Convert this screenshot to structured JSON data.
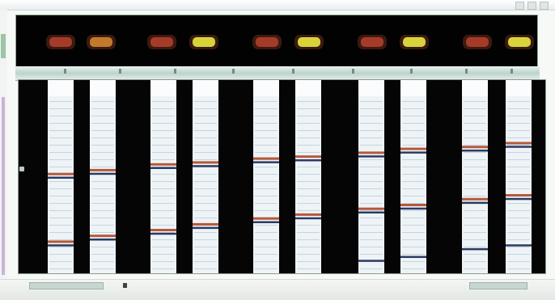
{
  "colors": {
    "panel_background": "#040404",
    "lane_background": "#eef3f6",
    "top_well_red": "#a63a28",
    "top_well_yellow": "#d9d33b",
    "band_red": "#b5583a",
    "band_dark": "#2c3a63",
    "band_cyan": "#4aa3b8"
  },
  "icons": {
    "minimize": "minimize-icon",
    "maximize": "maximize-icon",
    "close": "close-icon"
  },
  "top_wells": [
    {
      "name": "top-well-1",
      "color": "red"
    },
    {
      "name": "top-well-2",
      "color": "orange"
    },
    {
      "name": "top-well-3",
      "color": "red"
    },
    {
      "name": "top-well-4",
      "color": "yellow"
    },
    {
      "name": "top-well-5",
      "color": "red"
    },
    {
      "name": "top-well-6",
      "color": "yellow"
    },
    {
      "name": "top-well-7",
      "color": "red"
    },
    {
      "name": "top-well-8",
      "color": "yellow"
    },
    {
      "name": "top-well-9",
      "color": "red"
    },
    {
      "name": "top-well-10",
      "color": "yellow"
    }
  ],
  "lanes": [
    {
      "name": "lane-1",
      "bands": [
        {
          "level": 0.48,
          "tone": "red"
        },
        {
          "level": 0.5,
          "tone": "dark"
        },
        {
          "level": 0.83,
          "tone": "red"
        },
        {
          "level": 0.85,
          "tone": "dark"
        }
      ]
    },
    {
      "name": "lane-2",
      "bands": [
        {
          "level": 0.46,
          "tone": "red"
        },
        {
          "level": 0.48,
          "tone": "dark"
        },
        {
          "level": 0.8,
          "tone": "red"
        },
        {
          "level": 0.82,
          "tone": "dark"
        }
      ]
    },
    {
      "name": "lane-3",
      "bands": [
        {
          "level": 0.43,
          "tone": "red"
        },
        {
          "level": 0.45,
          "tone": "dark"
        },
        {
          "level": 0.77,
          "tone": "red"
        },
        {
          "level": 0.79,
          "tone": "dark"
        }
      ]
    },
    {
      "name": "lane-4",
      "bands": [
        {
          "level": 0.42,
          "tone": "red"
        },
        {
          "level": 0.44,
          "tone": "dark"
        },
        {
          "level": 0.74,
          "tone": "red"
        },
        {
          "level": 0.76,
          "tone": "dark"
        }
      ]
    },
    {
      "name": "lane-5",
      "bands": [
        {
          "level": 0.4,
          "tone": "red"
        },
        {
          "level": 0.42,
          "tone": "dark"
        },
        {
          "level": 0.71,
          "tone": "red"
        },
        {
          "level": 0.73,
          "tone": "dark"
        }
      ]
    },
    {
      "name": "lane-6",
      "bands": [
        {
          "level": 0.39,
          "tone": "red"
        },
        {
          "level": 0.41,
          "tone": "dark"
        },
        {
          "level": 0.69,
          "tone": "red"
        },
        {
          "level": 0.71,
          "tone": "dark"
        }
      ]
    },
    {
      "name": "lane-7",
      "bands": [
        {
          "level": 0.37,
          "tone": "red"
        },
        {
          "level": 0.39,
          "tone": "dark"
        },
        {
          "level": 0.66,
          "tone": "red"
        },
        {
          "level": 0.68,
          "tone": "dark"
        },
        {
          "level": 0.93,
          "tone": "dark"
        }
      ]
    },
    {
      "name": "lane-8",
      "bands": [
        {
          "level": 0.35,
          "tone": "red"
        },
        {
          "level": 0.37,
          "tone": "dark"
        },
        {
          "level": 0.64,
          "tone": "red"
        },
        {
          "level": 0.66,
          "tone": "dark"
        },
        {
          "level": 0.91,
          "tone": "dark"
        }
      ]
    },
    {
      "name": "lane-9",
      "bands": [
        {
          "level": 0.34,
          "tone": "red"
        },
        {
          "level": 0.36,
          "tone": "dark"
        },
        {
          "level": 0.61,
          "tone": "red"
        },
        {
          "level": 0.63,
          "tone": "dark"
        },
        {
          "level": 0.87,
          "tone": "dark"
        }
      ]
    },
    {
      "name": "lane-10",
      "bands": [
        {
          "level": 0.32,
          "tone": "red"
        },
        {
          "level": 0.34,
          "tone": "dark"
        },
        {
          "level": 0.59,
          "tone": "red"
        },
        {
          "level": 0.61,
          "tone": "dark"
        },
        {
          "level": 0.85,
          "tone": "dark"
        }
      ]
    }
  ]
}
